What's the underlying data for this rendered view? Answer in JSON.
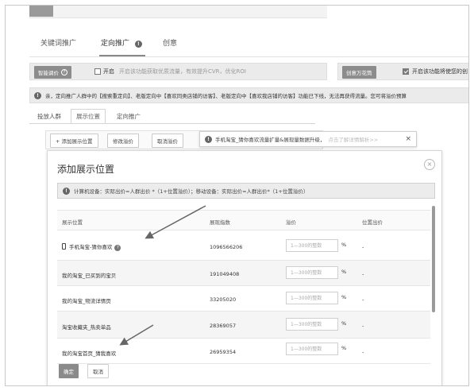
{
  "top_tabs": [
    {
      "label": "关键词推广"
    },
    {
      "label": "定向推广"
    },
    {
      "label": "创意"
    }
  ],
  "smart_bar": {
    "label": "智能调价",
    "enable_label": "开启",
    "enable_hint": "开启该功能获取优质流量，有效提升CVR，优化ROI",
    "right_label": "创意万花筒",
    "right_hint": "开启该功能将使您的创"
  },
  "notice": {
    "text": "亲，定向推广人群中的【搜索重定向】、老版定向中【喜欢同类店铺的访客】、老版定向中【喜欢我店铺的访客】功能已下线，无法再获得流量。您可将溢价预算"
  },
  "sub_tabs": [
    {
      "label": "投放人群"
    },
    {
      "label": "展示位置"
    },
    {
      "label": "定向推广"
    }
  ],
  "toolbar": {
    "add_label": "+ 添加展示位置",
    "modify_label": "修改溢价",
    "cancel_label": "取消溢价"
  },
  "toast": {
    "text": "手机淘宝_猜你喜欢流量扩量&展现量数据升级，",
    "link": "点击了解详情解析>>",
    "close": "×"
  },
  "modal": {
    "title": "添加展示位置",
    "close_symbol": "×",
    "formula": "计算机设备：实际出价=人群出价 *（1+位置溢价）；移动设备：实际出价=人群出价*（1+位置溢价）",
    "columns": [
      "展示位置",
      "展现指数",
      "溢价",
      "位置出价"
    ],
    "rows": [
      {
        "name": "手机淘宝-猜你喜欢",
        "index": "1096566206",
        "placeholder": "1—300的整数",
        "unit": "%",
        "bid": "-"
      },
      {
        "name": "我的淘宝_已买到的宝贝",
        "index": "191049408",
        "placeholder": "1—300的整数",
        "unit": "%",
        "bid": "-"
      },
      {
        "name": "我的淘宝_物流详情页",
        "index": "33205020",
        "placeholder": "1—300的整数",
        "unit": "%",
        "bid": "-"
      },
      {
        "name": "淘宝收藏夹_热卖单品",
        "index": "28369057",
        "placeholder": "1—300的整数",
        "unit": "%",
        "bid": "-"
      },
      {
        "name": "我的淘宝首页_猜我喜欢",
        "index": "26959354",
        "placeholder": "1—300的整数",
        "unit": "%",
        "bid": "-"
      }
    ],
    "confirm_label": "确定",
    "cancel_label": "取消"
  },
  "colors": {
    "dark_button": "#8a8a8a",
    "border": "#d6d6d6",
    "alt_row": "#f5f5f5"
  }
}
